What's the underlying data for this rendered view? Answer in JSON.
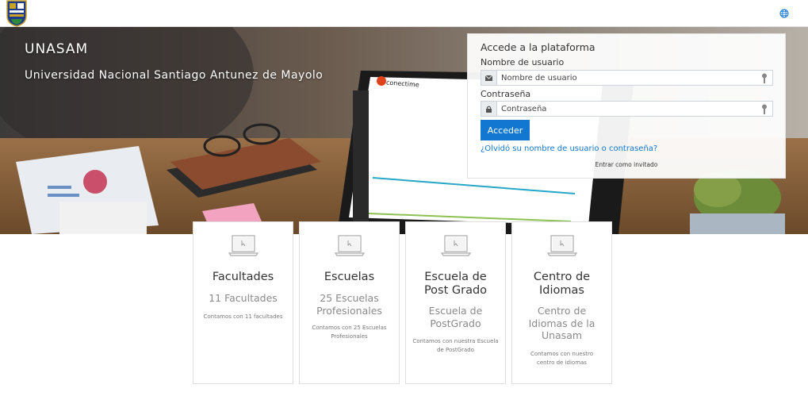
{
  "navbar": {
    "logo_icon": "university-shield-logo",
    "language_icon": "globe-icon"
  },
  "hero": {
    "title": "UNASAM",
    "subtitle": "Universidad Nacional Santiago Antunez de Mayolo",
    "laptop_brand": "conectime"
  },
  "login": {
    "heading": "Accede a la plataforma",
    "username_label": "Nombre de usuario",
    "username_placeholder": "Nombre de usuario",
    "password_label": "Contraseña",
    "password_placeholder": "Contraseña",
    "submit_label": "Acceder",
    "forgot_link": "¿Olvidó su nombre de usuario o contraseña?",
    "guest_link": "Entrar como invitado",
    "accent_color": "#1177d1"
  },
  "cards": [
    {
      "title": "Facultades",
      "subtitle": "11 Facultades",
      "description": "Contamos con 11 facultades"
    },
    {
      "title": "Escuelas",
      "subtitle": "25 Escuelas Profesionales",
      "description": "Contamos con 25 Escuelas Profesionales"
    },
    {
      "title": "Escuela de Post Grado",
      "subtitle": "Escuela de PostGrado",
      "description": "Contamos con nuestra Escuela de PostGrado"
    },
    {
      "title": "Centro de Idiomas",
      "subtitle": "Centro de Idiomas de la Unasam",
      "description": "Contamos con nuestro centro de idiomas"
    }
  ]
}
